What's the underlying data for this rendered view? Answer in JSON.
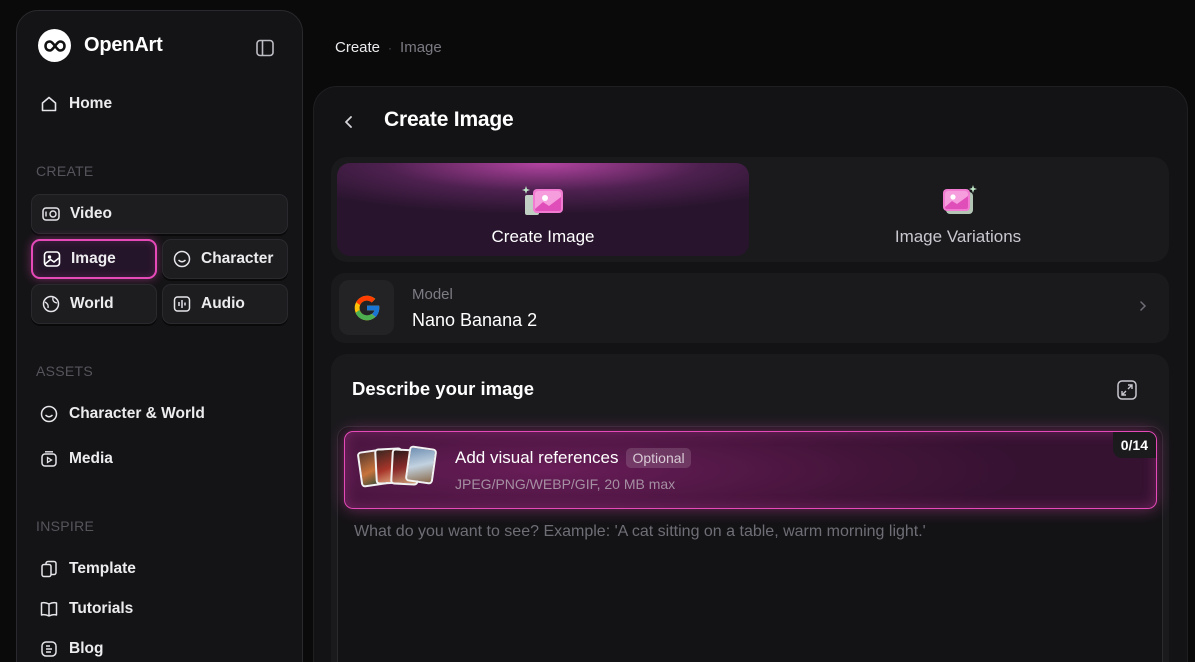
{
  "brand": {
    "name": "OpenArt"
  },
  "sidebar": {
    "home": "Home",
    "create_label": "CREATE",
    "create_items": [
      {
        "label": "Video",
        "icon": "video-icon"
      },
      {
        "label": "Image",
        "icon": "image-icon",
        "active": true
      },
      {
        "label": "Character",
        "icon": "character-icon"
      },
      {
        "label": "World",
        "icon": "world-icon"
      },
      {
        "label": "Audio",
        "icon": "audio-icon"
      }
    ],
    "assets_label": "ASSETS",
    "assets_items": [
      {
        "label": "Character & World",
        "icon": "character-icon"
      },
      {
        "label": "Media",
        "icon": "media-icon"
      }
    ],
    "inspire_label": "INSPIRE",
    "inspire_items": [
      {
        "label": "Template",
        "icon": "template-icon"
      },
      {
        "label": "Tutorials",
        "icon": "book-icon"
      },
      {
        "label": "Blog",
        "icon": "blog-icon"
      }
    ]
  },
  "breadcrumb": {
    "root": "Create",
    "separator": "·",
    "current": "Image"
  },
  "main": {
    "title": "Create Image",
    "tabs": [
      {
        "label": "Create Image",
        "active": true
      },
      {
        "label": "Image Variations",
        "active": false
      }
    ],
    "model": {
      "label": "Model",
      "value": "Nano Banana 2",
      "provider_icon": "google-icon"
    },
    "describe": {
      "title": "Describe your image",
      "references": {
        "title": "Add visual references",
        "optional": "Optional",
        "formats": "JPEG/PNG/WEBP/GIF, 20 MB max",
        "count": "0/14"
      },
      "prompt_placeholder": "What do you want to see? Example: 'A cat sitting on a table, warm morning light.'"
    }
  },
  "colors": {
    "accent": "#e54ab8",
    "background": "#0a0a0b",
    "panel": "#1a1a1d"
  }
}
